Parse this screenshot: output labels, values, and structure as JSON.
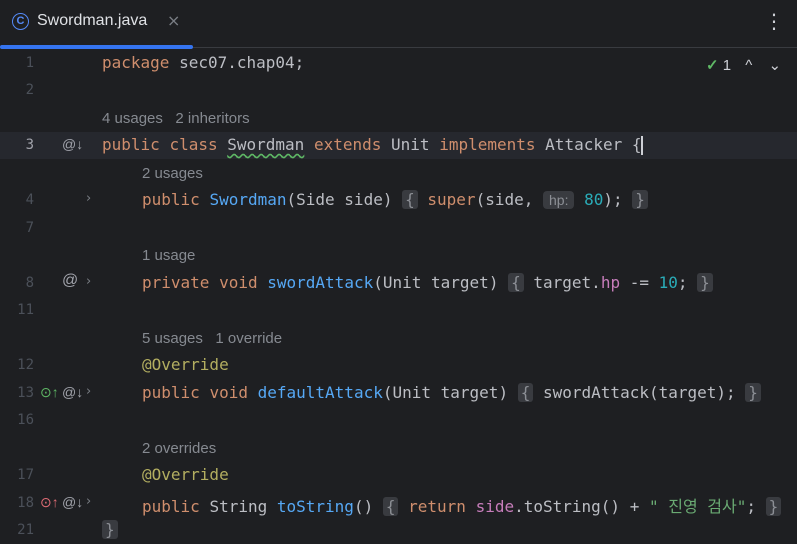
{
  "tab": {
    "title": "Swordman.java",
    "close": "×",
    "class_glyph": "C"
  },
  "menu": {
    "more": "⋮"
  },
  "status": {
    "check": "✓",
    "count": "1",
    "up": "^",
    "down": "⌄"
  },
  "lines": {
    "l1": {
      "num": "1",
      "kw": "package",
      "rest": " sec07.chap04;"
    },
    "l2": {
      "num": "2"
    },
    "h3": {
      "usages": "4 usages",
      "inheritors": "2 inheritors"
    },
    "l3": {
      "num": "3",
      "kw1": "public",
      "kw2": "class",
      "name": "Swordman",
      "kw3": "extends",
      "base": "Unit",
      "kw4": "implements",
      "iface": "Attacker",
      "brace": "{"
    },
    "h4": {
      "usages": "2 usages"
    },
    "l4": {
      "num": "4",
      "kw": "public",
      "fn": "Swordman",
      "params": "(Side side)",
      "open": "{",
      "sup": "super",
      "args": "(side,",
      "hint": "hp:",
      "val": "80",
      "close_paren": ");",
      "close": "}"
    },
    "l7": {
      "num": "7"
    },
    "h8": {
      "usages": "1 usage"
    },
    "l8": {
      "num": "8",
      "kw1": "private",
      "kw2": "void",
      "fn": "swordAttack",
      "params": "(Unit target)",
      "open": "{",
      "obj": "target.",
      "field": "hp",
      "op": " -= ",
      "val": "10",
      "semi": ";",
      "close": "}"
    },
    "l11": {
      "num": "11"
    },
    "h12": {
      "usages": "5 usages",
      "overrides": "1 override"
    },
    "l12": {
      "num": "12",
      "ann": "@Override"
    },
    "l13": {
      "num": "13",
      "kw1": "public",
      "kw2": "void",
      "fn": "defaultAttack",
      "params": "(Unit target)",
      "open": "{",
      "body": "swordAttack(target);",
      "close": "}"
    },
    "l16": {
      "num": "16"
    },
    "h17": {
      "overrides": "2 overrides"
    },
    "l17": {
      "num": "17",
      "ann": "@Override"
    },
    "l18": {
      "num": "18",
      "kw1": "public",
      "type": "String",
      "fn": "toString",
      "params": "()",
      "open": "{",
      "ret": "return",
      "fld": "side",
      "call": ".toString() + ",
      "str": "\" 진영 검사\"",
      "semi": ";",
      "close": "}"
    },
    "l21": {
      "num": "21",
      "brace": "}"
    }
  },
  "gutter": {
    "at": "@",
    "chevron": "›",
    "impl_icon": "@↓",
    "override_icon": "⊙↑"
  }
}
